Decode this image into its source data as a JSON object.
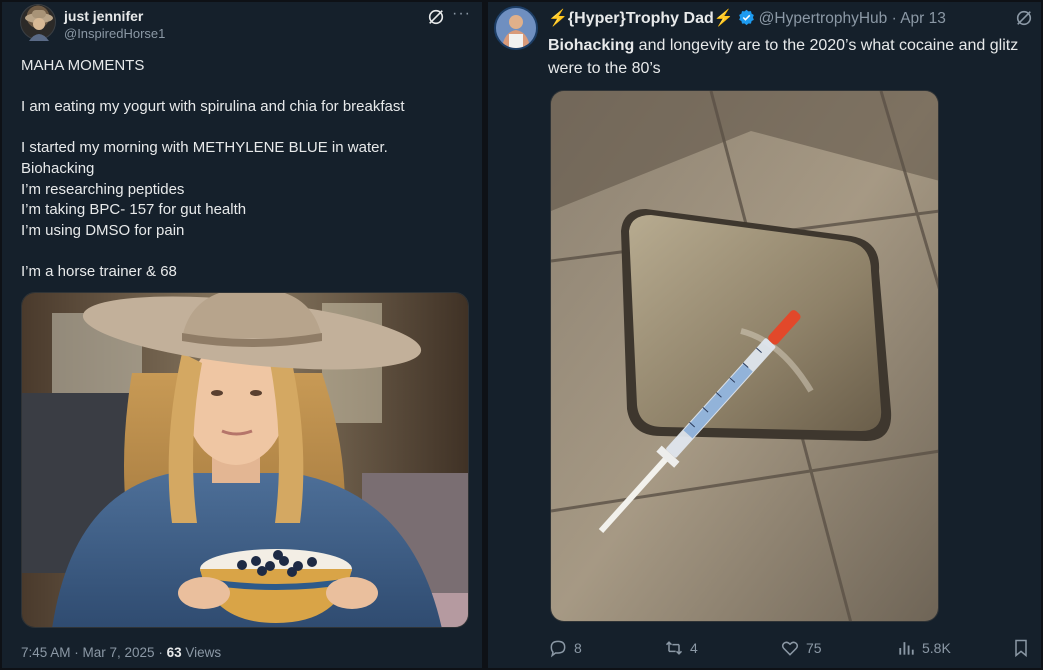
{
  "left_tweet": {
    "author_name": "just jennifer",
    "author_handle": "@InspiredHorse1",
    "grok_icon": "grok-icon",
    "more_icon": "more-icon",
    "more_label": "···",
    "lines": [
      "MAHA MOMENTS",
      "",
      "I am eating my yogurt with spirulina and chia for breakfast",
      "",
      "I started my morning with METHYLENE BLUE in water.",
      "Biohacking",
      "I’m researching peptides",
      "I’m taking BPC- 157 for gut health",
      "I’m using DMSO for pain",
      "",
      "I’m a horse trainer & 68"
    ],
    "meta_time": "7:45 AM · Mar 7, 2025 · ",
    "meta_views_count": "63",
    "meta_views_label": " Views"
  },
  "right_tweet": {
    "name_prefix_emoji": "⚡",
    "author_name": "{Hyper}Trophy Dad",
    "name_suffix_emoji": "⚡",
    "verified_icon": "verified-badge-icon",
    "author_handle": "@HypertrophyHub",
    "separator": " · ",
    "date": "Apr 13",
    "text_bold": "Biohacking",
    "text_rest": " and longevity are to the 2020’s what cocaine and glitz were to the 80’s",
    "actions": {
      "replies": "8",
      "reposts": "4",
      "likes": "75",
      "views": "5.8K"
    }
  },
  "colors": {
    "background": "#15202b",
    "text": "#e7e9ea",
    "muted": "#8b98a5",
    "verified": "#1d9bf0",
    "bolt": "#f7b500"
  }
}
